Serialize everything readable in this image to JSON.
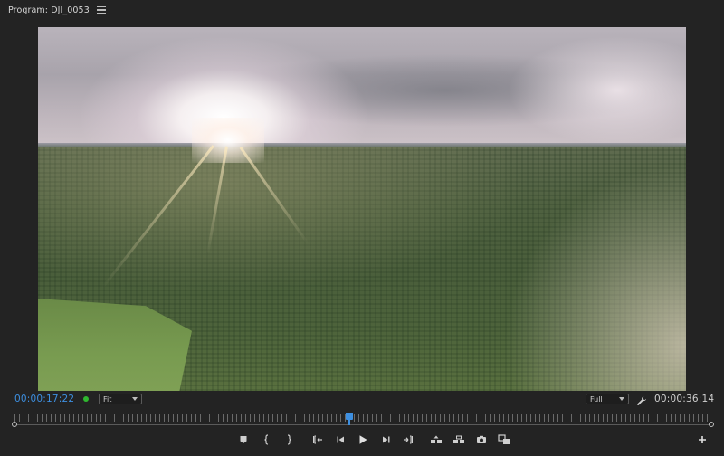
{
  "panel": {
    "title": "Program: DJI_0053"
  },
  "controls": {
    "current_time": "00:00:17:22",
    "zoom_value": "Fit",
    "resolution_value": "Full",
    "duration": "00:00:36:14",
    "status_color": "#2fb82f",
    "accent_color": "#3d8fe0"
  },
  "timeline": {
    "playhead_position_fraction": 0.48
  },
  "transport": {
    "buttons": [
      "add-marker-icon",
      "mark-in-icon",
      "mark-out-icon",
      "go-to-in-icon",
      "step-back-icon",
      "play-icon",
      "step-forward-icon",
      "go-to-out-icon",
      "lift-icon",
      "extract-icon",
      "export-frame-icon",
      "comparison-view-icon",
      "add-button-icon"
    ]
  }
}
